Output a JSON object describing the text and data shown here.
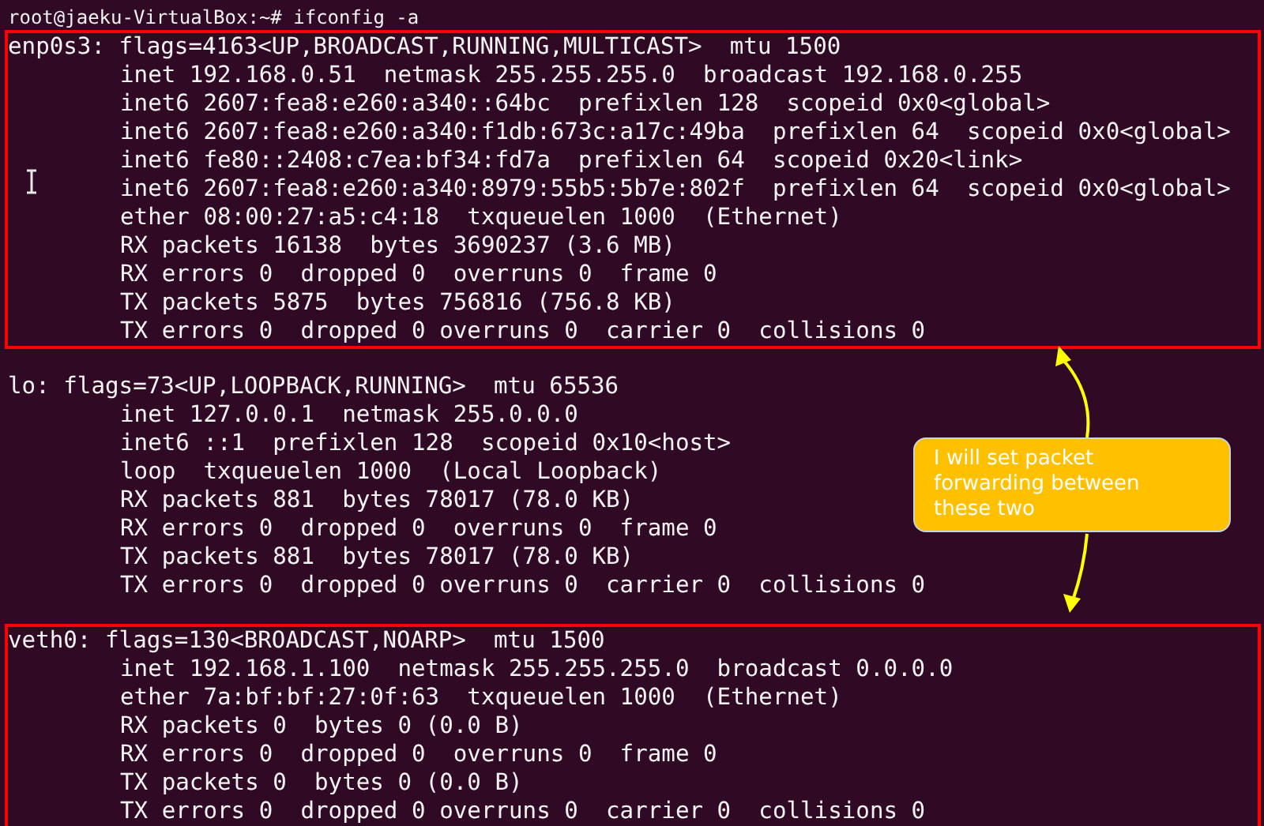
{
  "terminal": {
    "prompt": "root@jaeku-VirtualBox:~# ifconfig -a",
    "interfaces": [
      {
        "highlighted": true,
        "header": "enp0s3: flags=4163<UP,BROADCAST,RUNNING,MULTICAST>  mtu 1500",
        "details": [
          "inet 192.168.0.51  netmask 255.255.255.0  broadcast 192.168.0.255",
          "inet6 2607:fea8:e260:a340::64bc  prefixlen 128  scopeid 0x0<global>",
          "inet6 2607:fea8:e260:a340:f1db:673c:a17c:49ba  prefixlen 64  scopeid 0x0<global>",
          "inet6 fe80::2408:c7ea:bf34:fd7a  prefixlen 64  scopeid 0x20<link>",
          "inet6 2607:fea8:e260:a340:8979:55b5:5b7e:802f  prefixlen 64  scopeid 0x0<global>",
          "ether 08:00:27:a5:c4:18  txqueuelen 1000  (Ethernet)",
          "RX packets 16138  bytes 3690237 (3.6 MB)",
          "RX errors 0  dropped 0  overruns 0  frame 0",
          "TX packets 5875  bytes 756816 (756.8 KB)",
          "TX errors 0  dropped 0 overruns 0  carrier 0  collisions 0"
        ]
      },
      {
        "highlighted": false,
        "header": "lo: flags=73<UP,LOOPBACK,RUNNING>  mtu 65536",
        "details": [
          "inet 127.0.0.1  netmask 255.0.0.0",
          "inet6 ::1  prefixlen 128  scopeid 0x10<host>",
          "loop  txqueuelen 1000  (Local Loopback)",
          "RX packets 881  bytes 78017 (78.0 KB)",
          "RX errors 0  dropped 0  overruns 0  frame 0",
          "TX packets 881  bytes 78017 (78.0 KB)",
          "TX errors 0  dropped 0 overruns 0  carrier 0  collisions 0"
        ]
      },
      {
        "highlighted": true,
        "header": "veth0: flags=130<BROADCAST,NOARP>  mtu 1500",
        "details": [
          "inet 192.168.1.100  netmask 255.255.255.0  broadcast 0.0.0.0",
          "ether 7a:bf:bf:27:0f:63  txqueuelen 1000  (Ethernet)",
          "RX packets 0  bytes 0 (0.0 B)",
          "RX errors 0  dropped 0  overruns 0  frame 0",
          "TX packets 0  bytes 0 (0.0 B)",
          "TX errors 0  dropped 0 overruns 0  carrier 0  collisions 0"
        ]
      }
    ]
  },
  "annotation": {
    "text": "I will set packet forwarding between these two"
  }
}
